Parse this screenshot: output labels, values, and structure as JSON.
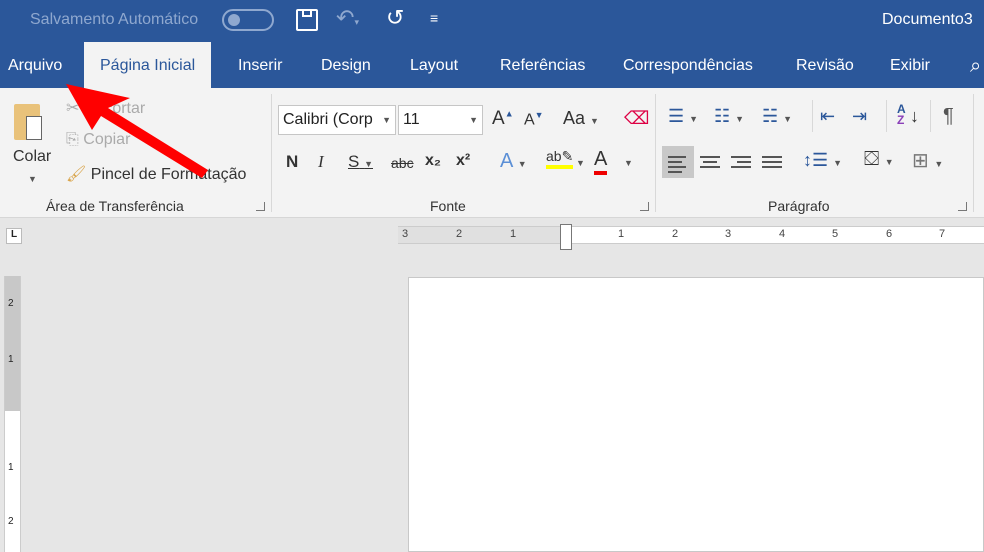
{
  "titlebar": {
    "autosave_label": "Salvamento Automático",
    "doc_title": "Documento3",
    "icons": [
      "save-icon",
      "undo-icon",
      "redo-icon",
      "customize-icon"
    ]
  },
  "tabs": [
    "Arquivo",
    "Página Inicial",
    "Inserir",
    "Design",
    "Layout",
    "Referências",
    "Correspondências",
    "Revisão",
    "Exibir"
  ],
  "clipboard": {
    "paste": "Colar",
    "cut": "Recortar",
    "copy": "Copiar",
    "format_painter": "Pincel de Formatação",
    "group": "Área de Transferência"
  },
  "font": {
    "name": "Calibri (Corp",
    "size": "11",
    "bold": "N",
    "italic": "I",
    "underline": "S",
    "strike": "abc",
    "sub": "x₂",
    "sup": "x²",
    "case": "Aa",
    "group": "Fonte"
  },
  "paragraph": {
    "group": "Parágrafo",
    "pilcrow": "¶"
  },
  "ruler": {
    "h_labels": [
      "3",
      "2",
      "1",
      "1",
      "2",
      "3",
      "4",
      "5",
      "6",
      "7"
    ],
    "v_labels": [
      "2",
      "1",
      "1",
      "2"
    ]
  },
  "colors": {
    "brand": "#2b579a",
    "arrow": "#ff0000"
  }
}
